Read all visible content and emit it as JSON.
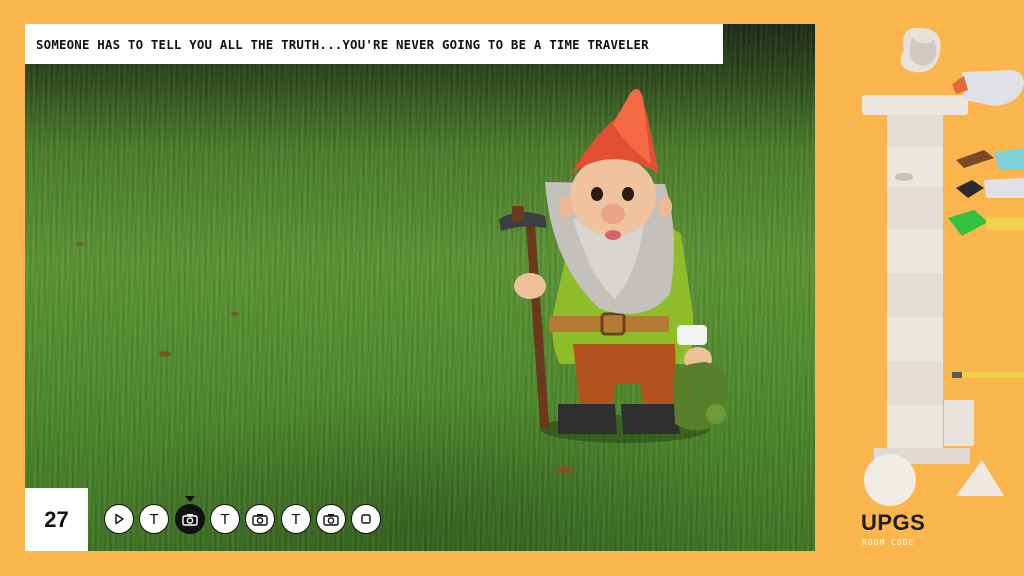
{
  "caption": "SOMEONE HAS TO TELL YOU ALL THE TRUTH...YOU'RE NEVER GOING TO BE A TIME TRAVELER",
  "counter": "27",
  "steps": [
    {
      "type": "play",
      "icon": "play-icon"
    },
    {
      "type": "text",
      "label": "T",
      "icon": "text-icon"
    },
    {
      "type": "photo",
      "icon": "camera-icon",
      "active": true
    },
    {
      "type": "text",
      "label": "T",
      "icon": "text-icon"
    },
    {
      "type": "photo",
      "icon": "camera-icon"
    },
    {
      "type": "text",
      "label": "T",
      "icon": "text-icon"
    },
    {
      "type": "photo",
      "icon": "camera-icon"
    },
    {
      "type": "stop",
      "icon": "stop-icon"
    }
  ],
  "brand": {
    "name": "UPGS",
    "sub": "ROOM CODE"
  },
  "colors": {
    "background": "#fbb54d",
    "panel": "#ffffff",
    "ink": "#111111"
  }
}
